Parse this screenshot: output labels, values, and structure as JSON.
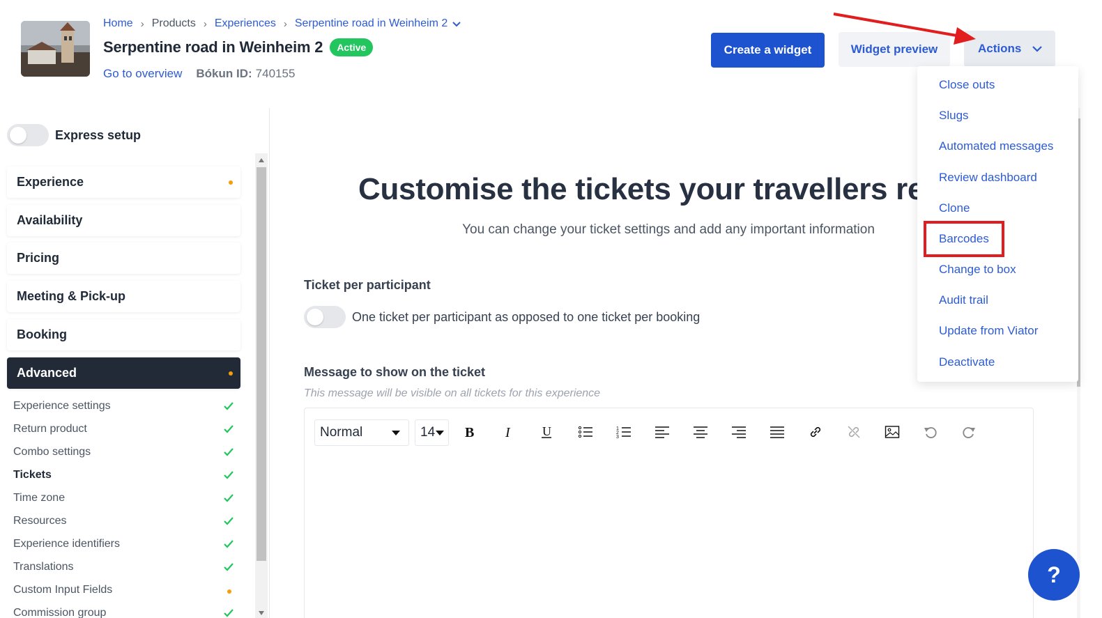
{
  "breadcrumb": {
    "home": "Home",
    "products": "Products",
    "experiences": "Experiences",
    "current": "Serpentine road in Weinheim 2"
  },
  "header": {
    "title": "Serpentine road in Weinheim 2",
    "status": "Active",
    "overview_link": "Go to overview",
    "bokun_label": "Bókun ID:",
    "bokun_id": "740155",
    "create_widget": "Create a widget",
    "widget_preview": "Widget preview",
    "actions": "Actions"
  },
  "actions_menu": [
    "Close outs",
    "Slugs",
    "Automated messages",
    "Review dashboard",
    "Clone",
    "Barcodes",
    "Change to box",
    "Audit trail",
    "Update from Viator",
    "Deactivate"
  ],
  "sidebar": {
    "express_setup": "Express setup",
    "nav": [
      {
        "label": "Experience",
        "dot": true
      },
      {
        "label": "Availability",
        "dot": false
      },
      {
        "label": "Pricing",
        "dot": false
      },
      {
        "label": "Meeting & Pick-up",
        "dot": false
      },
      {
        "label": "Booking",
        "dot": false
      },
      {
        "label": "Advanced",
        "dot": true,
        "active": true
      }
    ],
    "sub_items": [
      {
        "label": "Experience settings",
        "status": "check"
      },
      {
        "label": "Return product",
        "status": "check"
      },
      {
        "label": "Combo settings",
        "status": "check"
      },
      {
        "label": "Tickets",
        "status": "check",
        "current": true
      },
      {
        "label": "Time zone",
        "status": "check"
      },
      {
        "label": "Resources",
        "status": "check"
      },
      {
        "label": "Experience identifiers",
        "status": "check"
      },
      {
        "label": "Translations",
        "status": "check"
      },
      {
        "label": "Custom Input Fields",
        "status": "dot"
      },
      {
        "label": "Commission group",
        "status": "check"
      }
    ]
  },
  "main": {
    "heading": "Customise the tickets your travellers rec",
    "subheading": "You can change your ticket settings and add any important information",
    "ticket_per_participant_label": "Ticket per participant",
    "ticket_per_participant_text": "One ticket per participant as opposed to one ticket per booking",
    "message_label": "Message to show on the ticket",
    "message_hint": "This message will be visible on all tickets for this experience",
    "editor": {
      "format": "Normal",
      "font_size": "14"
    }
  },
  "help_button": "?",
  "colors": {
    "primary": "#1e53d0",
    "link": "#2c5bd4",
    "active_badge": "#22c55e",
    "nav_active": "#222a38",
    "dot_warning": "#f59e0b",
    "check": "#22c55e",
    "annotation": "#e11d1d"
  }
}
